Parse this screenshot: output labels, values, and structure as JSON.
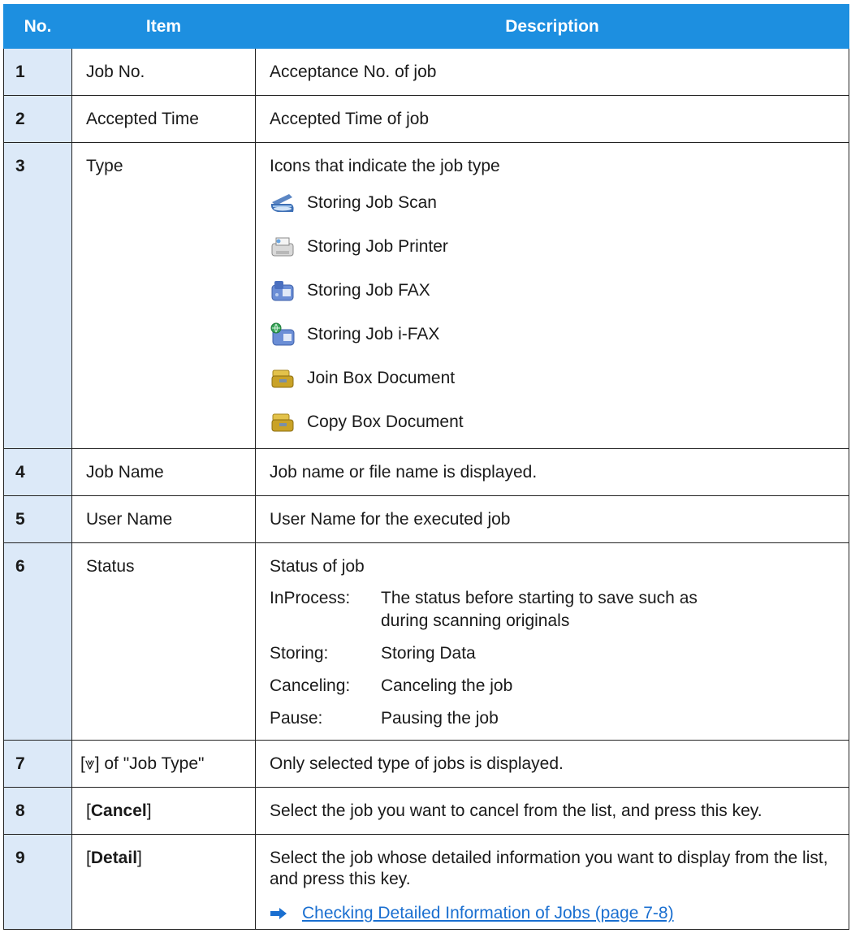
{
  "headers": {
    "no": "No.",
    "item": "Item",
    "description": "Description"
  },
  "rows": [
    {
      "no": "1",
      "item": "Job No.",
      "desc": "Acceptance No. of job"
    },
    {
      "no": "2",
      "item": "Accepted Time",
      "desc": "Accepted Time of job"
    },
    {
      "no": "3",
      "item": "Type",
      "desc": "Icons that indicate the job type",
      "types": [
        {
          "icon": "scan-icon",
          "label": "Storing Job Scan"
        },
        {
          "icon": "printer-icon",
          "label": "Storing Job Printer"
        },
        {
          "icon": "fax-icon",
          "label": "Storing Job FAX"
        },
        {
          "icon": "ifax-icon",
          "label": "Storing Job i-FAX"
        },
        {
          "icon": "box-icon",
          "label": "Join Box Document"
        },
        {
          "icon": "box-icon",
          "label": "Copy Box Document"
        }
      ]
    },
    {
      "no": "4",
      "item": "Job Name",
      "desc": "Job name or file name is displayed."
    },
    {
      "no": "5",
      "item": "User Name",
      "desc": "User Name for the executed job"
    },
    {
      "no": "6",
      "item": "Status",
      "desc": "Status of job",
      "statuses": [
        {
          "key": "InProcess:",
          "value": "The status before starting to save such as during scanning originals"
        },
        {
          "key": "Storing:",
          "value": "Storing Data"
        },
        {
          "key": "Canceling:",
          "value": "Canceling the job"
        },
        {
          "key": "Pause:",
          "value": "Pausing the job"
        }
      ]
    },
    {
      "no": "7",
      "item_prefix": "[",
      "item_icon": "⩔",
      "item_suffix": "] of \"Job Type\"",
      "desc": "Only selected type of jobs is displayed."
    },
    {
      "no": "8",
      "item_open": "[",
      "item_bold": "Cancel",
      "item_close": "]",
      "desc": "Select the job you want to cancel from the list, and press this key."
    },
    {
      "no": "9",
      "item_open": "[",
      "item_bold": "Detail",
      "item_close": "]",
      "desc": "Select the job whose detailed information you want to display from the list, and press this key.",
      "link": "Checking Detailed Information of Jobs (page 7-8)"
    }
  ]
}
